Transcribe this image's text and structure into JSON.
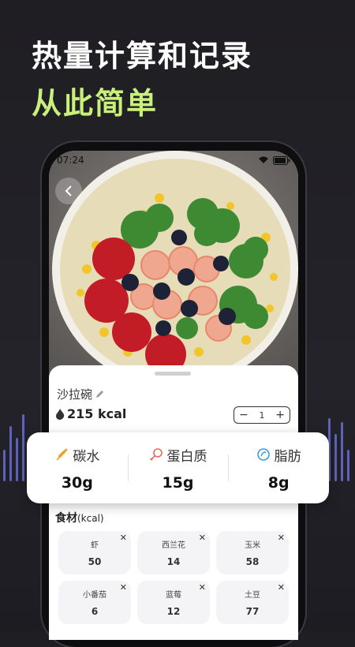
{
  "headline": {
    "line1": "热量计算和记录",
    "line2": "从此简单"
  },
  "status_bar": {
    "time": "07:24"
  },
  "food": {
    "name": "沙拉碗",
    "calories": "215 kcal",
    "quantity": "1"
  },
  "macros": [
    {
      "label": "碳水",
      "value": "30g",
      "icon": "wheat-icon",
      "color": "#f0a22c"
    },
    {
      "label": "蛋白质",
      "value": "15g",
      "icon": "drumstick-icon",
      "color": "#e86a5e"
    },
    {
      "label": "脂肪",
      "value": "8g",
      "icon": "oil-drop-icon",
      "color": "#3a9fd6"
    }
  ],
  "ingredients": {
    "title": "食材",
    "unit": "(kcal)",
    "items": [
      {
        "name": "虾",
        "kcal": "50"
      },
      {
        "name": "西兰花",
        "kcal": "14"
      },
      {
        "name": "玉米",
        "kcal": "58"
      },
      {
        "name": "小番茄",
        "kcal": "6"
      },
      {
        "name": "蓝莓",
        "kcal": "12"
      },
      {
        "name": "土豆",
        "kcal": "77"
      }
    ]
  },
  "colors": {
    "accent_green": "#c8f07a",
    "background": "#1f1e23"
  }
}
